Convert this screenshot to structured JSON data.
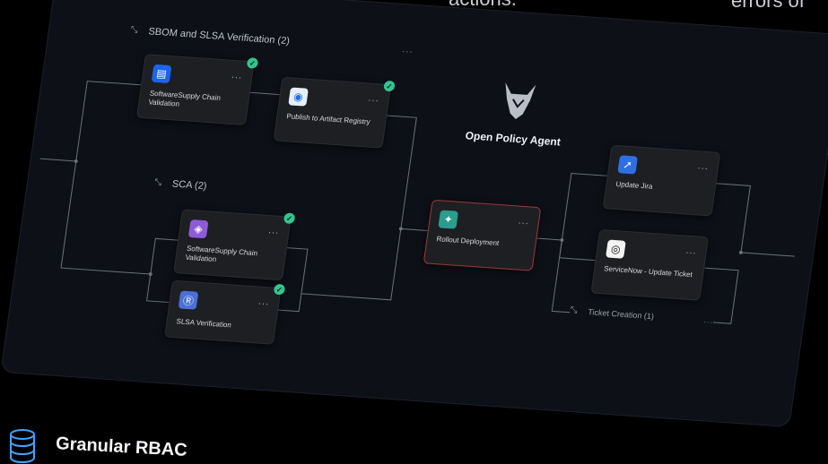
{
  "top_caption": {
    "left_text": "actions.",
    "right_text": "errors of"
  },
  "canvas": {
    "opa_label": "Open Policy Agent",
    "groups": {
      "sbom": {
        "label": "SBOM and SLSA Verification (2)",
        "more": "..."
      },
      "sca": {
        "label": "SCA (2)"
      },
      "ticket": {
        "label": "Ticket Creation (1)",
        "more": "..."
      }
    },
    "nodes": {
      "sbom_supply_chain": {
        "label": "SoftwareSupply Chain Validation",
        "dots": "...",
        "status": "passed"
      },
      "publish_registry": {
        "label": "Publish to Artifact Registry",
        "dots": "...",
        "status": "passed"
      },
      "sca_supply_chain": {
        "label": "SoftwareSupply Chain Validation",
        "dots": "...",
        "status": "passed"
      },
      "slsa_verification": {
        "label": "SLSA Verification",
        "dots": "...",
        "status": "passed"
      },
      "rollout_deployment": {
        "label": "Rollout Deployment",
        "dots": "..."
      },
      "update_jira": {
        "label": "Update Jira",
        "dots": "..."
      },
      "servicenow_ticket": {
        "label": "ServiceNow - Update Ticket",
        "dots": "..."
      }
    },
    "colors": {
      "accent_green": "#34c38f",
      "jira_blue": "#2f6fe4",
      "docker_blue": "#1d63ed",
      "rollout_teal": "#2a9d8f",
      "sca_purple": "#8e5bd6",
      "slsa_blue": "#4a6fd6"
    }
  },
  "footer": {
    "title": "Granular RBAC",
    "icon": "database-icon"
  }
}
